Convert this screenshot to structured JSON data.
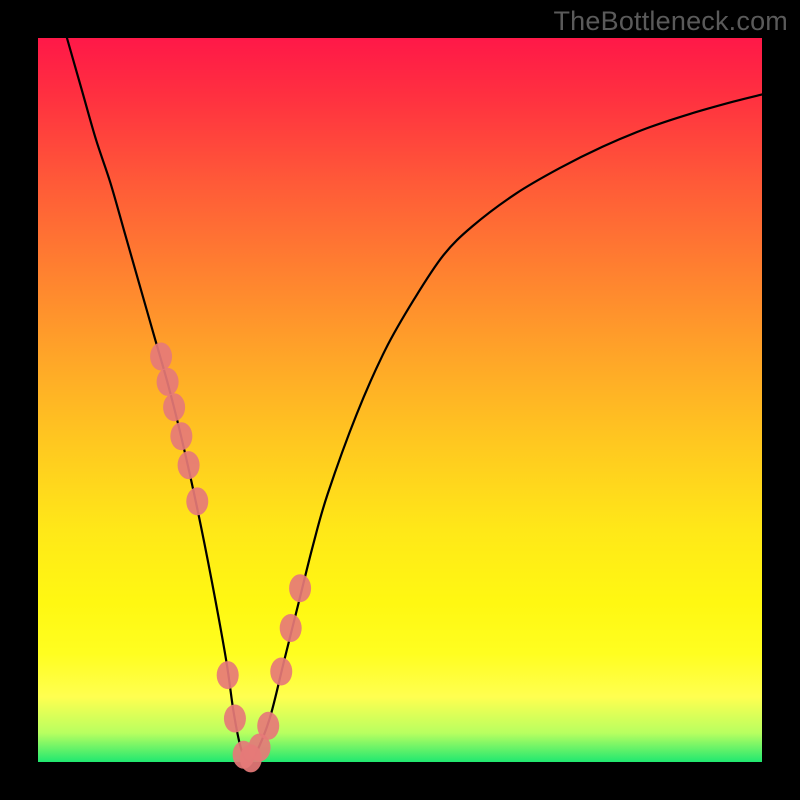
{
  "watermark": "TheBottleneck.com",
  "chart_data": {
    "type": "line",
    "title": "",
    "xlabel": "",
    "ylabel": "",
    "xlim": [
      0,
      100
    ],
    "ylim": [
      0,
      100
    ],
    "series": [
      {
        "name": "bottleneck-curve",
        "x": [
          4,
          6,
          8,
          10,
          12,
          14,
          16,
          18,
          20,
          22,
          24,
          26,
          27,
          28,
          29,
          30,
          32,
          34,
          36,
          38,
          40,
          44,
          48,
          52,
          56,
          60,
          66,
          72,
          78,
          84,
          90,
          96,
          100
        ],
        "values": [
          100,
          93,
          86,
          80,
          73,
          66,
          59,
          52,
          44,
          35,
          25,
          14,
          7,
          2,
          0,
          1,
          6,
          14,
          22,
          30,
          37,
          48,
          57,
          64,
          70,
          74,
          78.5,
          82,
          85,
          87.5,
          89.5,
          91.2,
          92.2
        ]
      }
    ],
    "markers": {
      "name": "highlight-points",
      "x": [
        17.0,
        17.9,
        18.8,
        19.8,
        20.8,
        22.0,
        26.2,
        27.2,
        28.4,
        29.4,
        30.6,
        31.8,
        33.6,
        34.9,
        36.2
      ],
      "values": [
        56.0,
        52.5,
        49.0,
        45.0,
        41.0,
        36.0,
        12.0,
        6.0,
        1.0,
        0.5,
        2.0,
        5.0,
        12.5,
        18.5,
        24.0
      ]
    },
    "colors": {
      "curve": "#000000",
      "markers": "#e67a78",
      "gradient_top": "#ff1848",
      "gradient_bottom": "#20e870"
    }
  }
}
